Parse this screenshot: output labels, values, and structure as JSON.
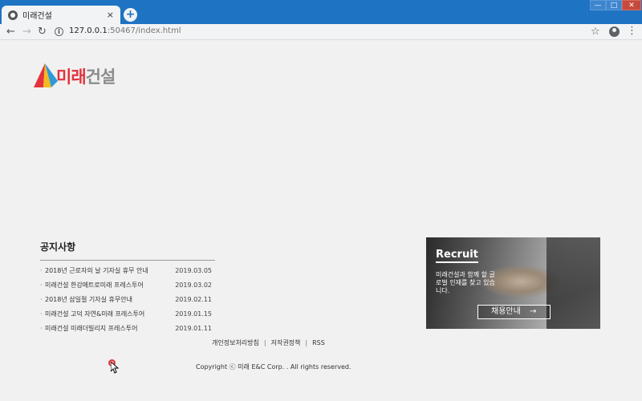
{
  "browser": {
    "tab_title": "미래건설",
    "tab_close": "×",
    "new_tab": "+",
    "window_controls": {
      "minimize": "—",
      "maximize": "□",
      "close": "✕"
    },
    "nav": {
      "back": "←",
      "forward": "→",
      "reload": "↻"
    },
    "url_host": "127.0.0.1",
    "url_path": ":50467/index.html",
    "star": "☆",
    "menu": "⋮"
  },
  "logo": {
    "text_red": "미래",
    "text_gray": "건설",
    "colors": [
      "#e2333d",
      "#2e9ad6",
      "#f5b91d",
      "#8c8c8c"
    ]
  },
  "notice": {
    "title": "공지사항",
    "items": [
      {
        "title": "2018년 근로자의 날 기자실 휴무 안내",
        "date": "2019.03.05"
      },
      {
        "title": "미래건설 한강메트로미래 프레스투어",
        "date": "2019.03.02"
      },
      {
        "title": "2018년 삼일절 기자실 휴무안내",
        "date": "2019.02.11"
      },
      {
        "title": "미래건설 고덕 자연&미래 프레스투어",
        "date": "2019.01.15"
      },
      {
        "title": "미래건설 미래더빌리지 프레스투어",
        "date": "2019.01.11"
      }
    ]
  },
  "recruit": {
    "title": "Recruit",
    "description": "미래건설과 함께 할 글로벌 인재를 찾고 있습니다.",
    "button_label": "채용안내",
    "button_arrow": "→"
  },
  "footer": {
    "links": [
      "개인정보처리방침",
      "저작권정책",
      "RSS"
    ],
    "copyright": "Copyright ⓒ 미래 E&C Corp. . All rights reserved."
  }
}
